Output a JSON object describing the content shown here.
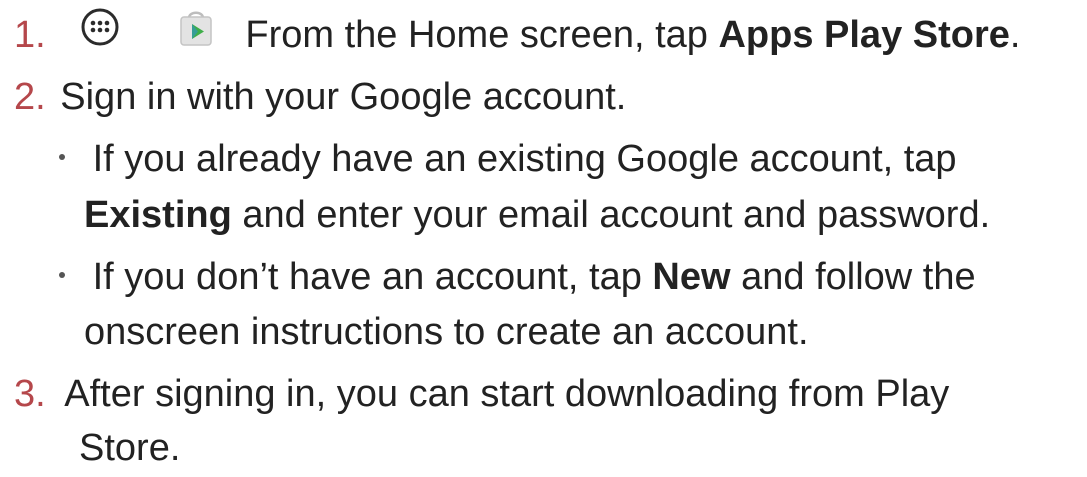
{
  "steps": [
    {
      "number": "1.",
      "text_before": "From the Home screen, tap ",
      "bold_text": "Apps Play Store",
      "text_after": ".",
      "icons": [
        "apps-icon",
        "play-store-icon"
      ]
    },
    {
      "number": "2.",
      "text": "Sign in with your Google account.",
      "bullets": [
        {
          "line1": "If you already have an existing Google account, tap",
          "line2_bold": "Existing",
          "line2_rest": " and enter your email account and password."
        },
        {
          "line1_before": "If you don’t have an account, tap ",
          "line1_bold": "New",
          "line1_after": " and follow the",
          "line2": "onscreen instructions to create an account."
        }
      ]
    },
    {
      "number": "3.",
      "line1": "After signing in, you can start downloading from Play",
      "line2": "Store."
    }
  ],
  "colors": {
    "step_number": "#b5474b",
    "text": "#222222",
    "apps_icon": "#2b2b2b",
    "play_store_bag": "#d9d9d9",
    "play_store_triangle": "#3fae49"
  }
}
